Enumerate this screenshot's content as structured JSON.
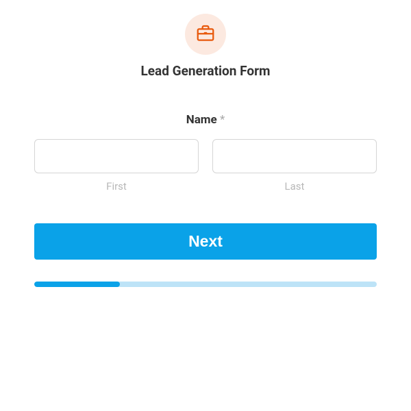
{
  "header": {
    "icon_name": "briefcase-icon",
    "title": "Lead Generation Form"
  },
  "form": {
    "name_label": "Name",
    "required_mark": "*",
    "first_sublabel": "First",
    "last_sublabel": "Last",
    "first_value": "",
    "last_value": "",
    "next_button": "Next"
  },
  "progress": {
    "percent": 25
  },
  "colors": {
    "accent": "#0aa2e8",
    "icon_bg": "#fce9e0",
    "icon_stroke": "#e8590c"
  }
}
